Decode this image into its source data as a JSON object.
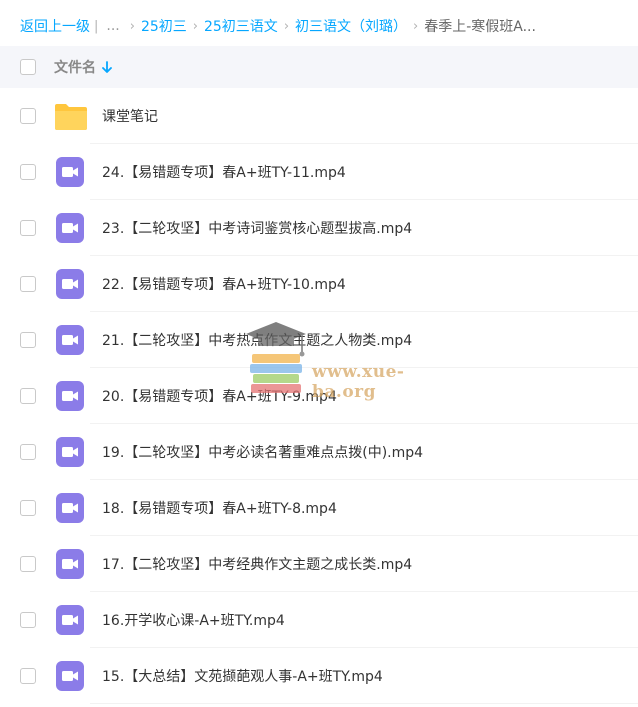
{
  "breadcrumb": {
    "back_label": "返回上一级",
    "divider": "|",
    "ellipsis": "...",
    "items": [
      "25初三",
      "25初三语文",
      "初三语文（刘璐）"
    ],
    "current": "春季上-寒假班A..."
  },
  "header": {
    "column_label": "文件名"
  },
  "files": [
    {
      "name": "课堂笔记",
      "type": "folder"
    },
    {
      "name": "24.【易错题专项】春A+班TY-11.mp4",
      "type": "video"
    },
    {
      "name": "23.【二轮攻坚】中考诗词鉴赏核心题型拔高.mp4",
      "type": "video"
    },
    {
      "name": "22.【易错题专项】春A+班TY-10.mp4",
      "type": "video"
    },
    {
      "name": "21.【二轮攻坚】中考热点作文主题之人物类.mp4",
      "type": "video"
    },
    {
      "name": "20.【易错题专项】春A+班TY-9.mp4",
      "type": "video"
    },
    {
      "name": "19.【二轮攻坚】中考必读名著重难点点拨(中).mp4",
      "type": "video"
    },
    {
      "name": "18.【易错题专项】春A+班TY-8.mp4",
      "type": "video"
    },
    {
      "name": "17.【二轮攻坚】中考经典作文主题之成长类.mp4",
      "type": "video"
    },
    {
      "name": "16.开学收心课-A+班TY.mp4",
      "type": "video"
    },
    {
      "name": "15.【大总结】文苑撷葩观人事-A+班TY.mp4",
      "type": "video"
    }
  ],
  "watermark": {
    "text": "www.xue-ba.org",
    "icon": "graduation-cap-books-icon"
  },
  "colors": {
    "link": "#06a7ff",
    "video_icon": "#8b7ce8",
    "folder_icon": "#ffc63d",
    "header_bg": "#f5f6fa"
  }
}
